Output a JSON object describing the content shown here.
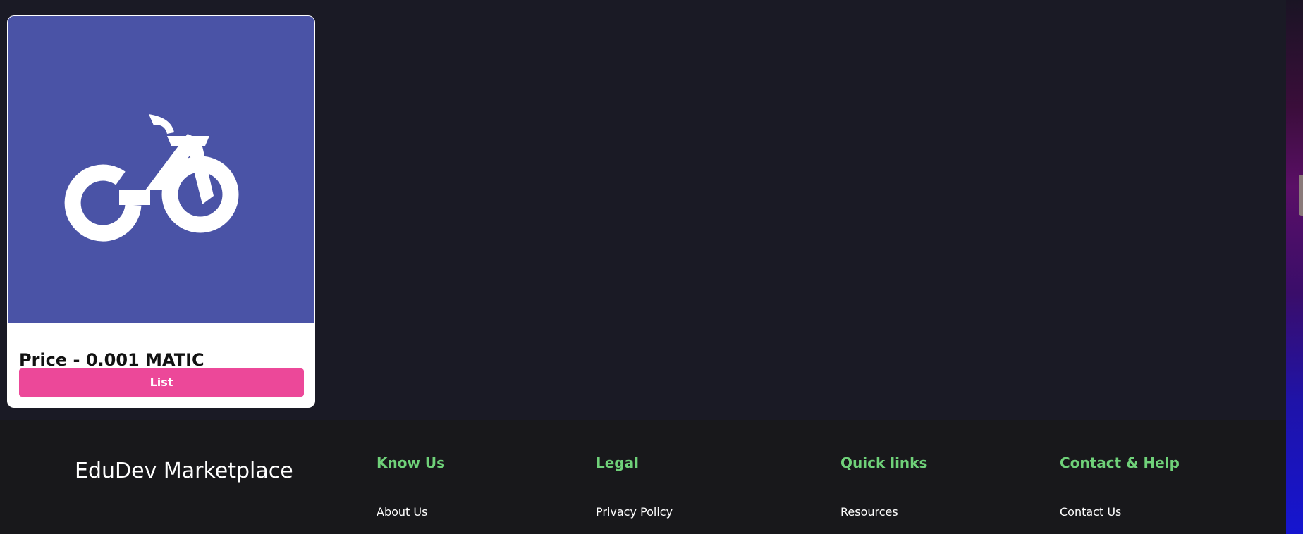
{
  "card": {
    "image_icon": "go-bike-logo-icon",
    "price_text": "Price - 0.001 MATIC",
    "list_button_label": "List",
    "image_bg_color": "#4a53a6",
    "button_color": "#ec4899"
  },
  "footer": {
    "brand": "EduDev Marketplace",
    "columns": [
      {
        "heading": "Know Us",
        "link": "About Us"
      },
      {
        "heading": "Legal",
        "link": "Privacy Policy"
      },
      {
        "heading": "Quick links",
        "link": "Resources"
      },
      {
        "heading": "Contact & Help",
        "link": "Contact Us"
      }
    ],
    "heading_color": "#6fd179"
  }
}
